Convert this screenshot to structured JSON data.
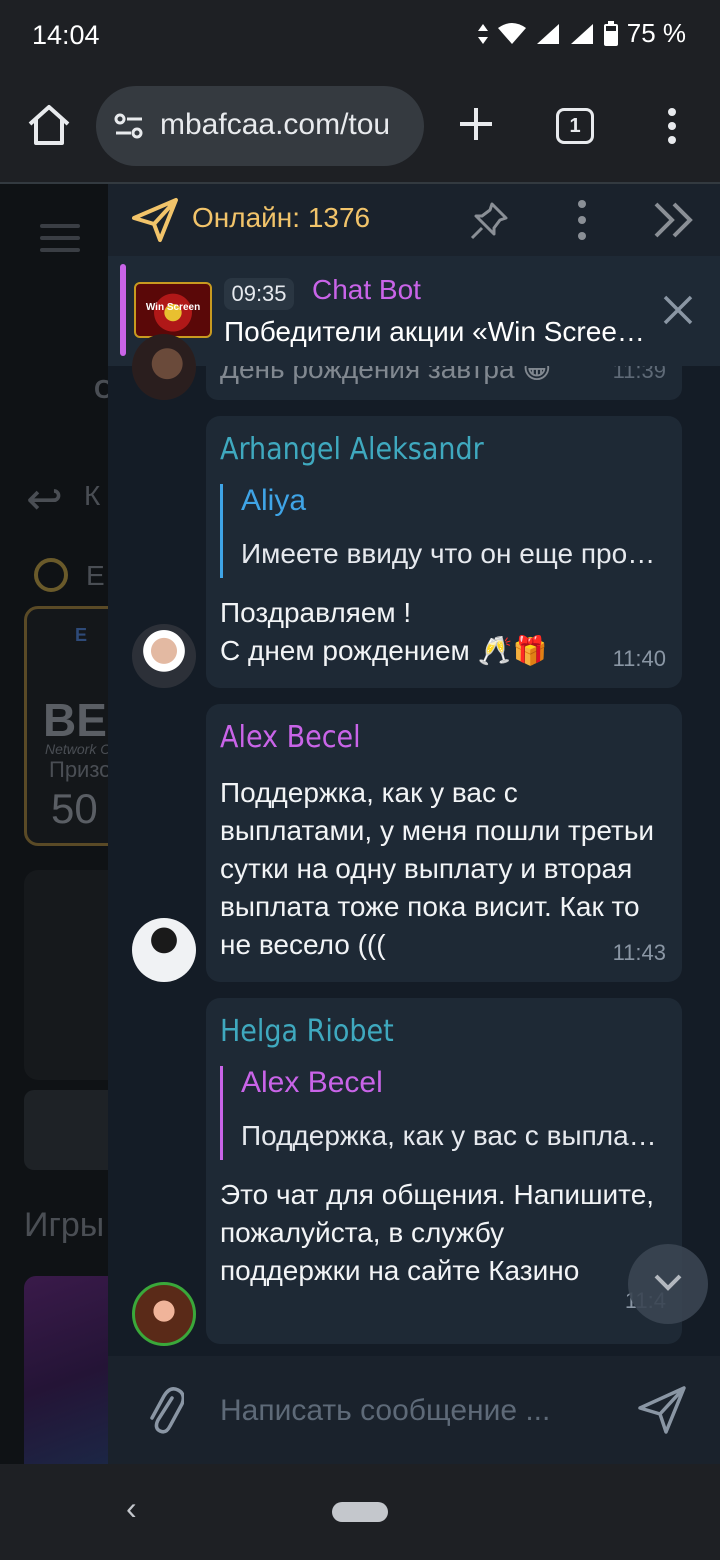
{
  "status_bar": {
    "time": "14:04",
    "battery": "75 %"
  },
  "browser": {
    "url": "mbafcaa.com/tou",
    "tab_count": "1"
  },
  "background_page": {
    "letter_c": "C",
    "letter_k": "К",
    "letter_e": "Е",
    "promo_logo": "E",
    "promo_big": "BE",
    "promo_network": "Network C",
    "promo_prize": "Призо",
    "promo_value": "50",
    "games_heading": "Игры"
  },
  "chat": {
    "online_label": "Онлайн: 1376",
    "pinned": {
      "time": "09:35",
      "author": "Chat Bot",
      "text": "Победители акции «Win Screen…",
      "thumb_text": "Win Screen"
    },
    "prev_message": {
      "text": "День рождения завтра 😁",
      "time": "11:39"
    },
    "messages": [
      {
        "author": "Arhangel Aleksandr",
        "author_color": "#3fa9bf",
        "quote_author": "Aliya",
        "quote_color": "#3fa4e6",
        "quote_text": "Имеете ввиду что он еще прос…",
        "body_line1": "Поздравляем !",
        "body_line2": "С днем рождением 🥂🎁",
        "time": "11:40"
      },
      {
        "author": "Alex Becel",
        "author_color": "#c964e8",
        "body_line1": "Поддержка, как у вас с",
        "body_line2": "выплатами, у меня пошли третьи",
        "body_line3": "сутки на одну выплату и вторая",
        "body_line4": "выплата тоже пока висит. Как то",
        "body_line5": "не весело (((",
        "time": "11:43"
      },
      {
        "author": "Helga Riobet",
        "author_color": "#3fa9bf",
        "quote_author": "Alex Becel",
        "quote_color": "#c964e8",
        "quote_text": "Поддержка, как у вас с выпла…",
        "body_line1": "Это чат для общения. Напишите,",
        "body_line2": "пожалуйста, в службу",
        "body_line3": "поддержки на сайте Казино",
        "time": "11:4"
      }
    ],
    "composer_placeholder": "Написать сообщение ..."
  }
}
